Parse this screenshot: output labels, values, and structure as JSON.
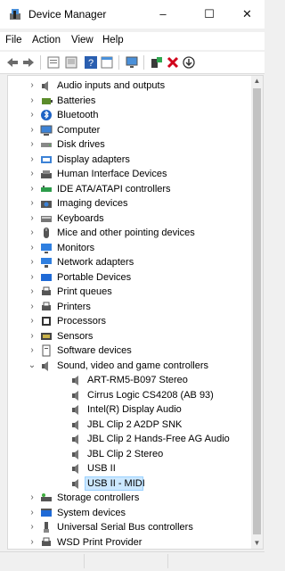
{
  "window": {
    "title": "Device Manager",
    "minimize": "–",
    "maximize": "☐",
    "close": "✕"
  },
  "menu": [
    "File",
    "Action",
    "View",
    "Help"
  ],
  "toolbar": [
    "back-icon",
    "forward-icon",
    "properties-icon",
    "show-hidden-icon",
    "help-icon",
    "view-icon",
    "monitor-icon",
    "add-driver-icon",
    "uninstall-icon",
    "update-icon"
  ],
  "tree": [
    {
      "label": "Audio inputs and outputs",
      "icon": "speaker-icon",
      "level": 0,
      "expanded": false
    },
    {
      "label": "Batteries",
      "icon": "battery-icon",
      "level": 0,
      "expanded": false
    },
    {
      "label": "Bluetooth",
      "icon": "bluetooth-icon",
      "level": 0,
      "expanded": false
    },
    {
      "label": "Computer",
      "icon": "computer-icon",
      "level": 0,
      "expanded": false
    },
    {
      "label": "Disk drives",
      "icon": "disk-icon",
      "level": 0,
      "expanded": false
    },
    {
      "label": "Display adapters",
      "icon": "display-adapter-icon",
      "level": 0,
      "expanded": false
    },
    {
      "label": "Human Interface Devices",
      "icon": "hid-icon",
      "level": 0,
      "expanded": false
    },
    {
      "label": "IDE ATA/ATAPI controllers",
      "icon": "ide-icon",
      "level": 0,
      "expanded": false
    },
    {
      "label": "Imaging devices",
      "icon": "camera-icon",
      "level": 0,
      "expanded": false
    },
    {
      "label": "Keyboards",
      "icon": "keyboard-icon",
      "level": 0,
      "expanded": false
    },
    {
      "label": "Mice and other pointing devices",
      "icon": "mouse-icon",
      "level": 0,
      "expanded": false
    },
    {
      "label": "Monitors",
      "icon": "monitor-icon",
      "level": 0,
      "expanded": false
    },
    {
      "label": "Network adapters",
      "icon": "network-icon",
      "level": 0,
      "expanded": false
    },
    {
      "label": "Portable Devices",
      "icon": "portable-icon",
      "level": 0,
      "expanded": false
    },
    {
      "label": "Print queues",
      "icon": "printer-icon",
      "level": 0,
      "expanded": false
    },
    {
      "label": "Printers",
      "icon": "printer-icon",
      "level": 0,
      "expanded": false
    },
    {
      "label": "Processors",
      "icon": "processor-icon",
      "level": 0,
      "expanded": false
    },
    {
      "label": "Sensors",
      "icon": "sensor-icon",
      "level": 0,
      "expanded": false
    },
    {
      "label": "Software devices",
      "icon": "software-icon",
      "level": 0,
      "expanded": false
    },
    {
      "label": "Sound, video and game controllers",
      "icon": "speaker-icon",
      "level": 0,
      "expanded": true
    },
    {
      "label": "ART-RM5-B097 Stereo",
      "icon": "speaker-icon",
      "level": 1
    },
    {
      "label": "Cirrus Logic CS4208 (AB 93)",
      "icon": "speaker-icon",
      "level": 1
    },
    {
      "label": "Intel(R) Display Audio",
      "icon": "speaker-icon",
      "level": 1
    },
    {
      "label": "JBL Clip 2 A2DP SNK",
      "icon": "speaker-icon",
      "level": 1
    },
    {
      "label": "JBL Clip 2 Hands-Free AG Audio",
      "icon": "speaker-icon",
      "level": 1
    },
    {
      "label": "JBL Clip 2 Stereo",
      "icon": "speaker-icon",
      "level": 1
    },
    {
      "label": "USB II",
      "icon": "speaker-icon",
      "level": 1
    },
    {
      "label": "USB II - MIDI",
      "icon": "speaker-icon",
      "level": 1,
      "selected": true
    },
    {
      "label": "Storage controllers",
      "icon": "storage-icon",
      "level": 0,
      "expanded": false
    },
    {
      "label": "System devices",
      "icon": "system-icon",
      "level": 0,
      "expanded": false
    },
    {
      "label": "Universal Serial Bus controllers",
      "icon": "usb-icon",
      "level": 0,
      "expanded": false
    },
    {
      "label": "WSD Print Provider",
      "icon": "printer-icon",
      "level": 0,
      "expanded": false
    }
  ]
}
